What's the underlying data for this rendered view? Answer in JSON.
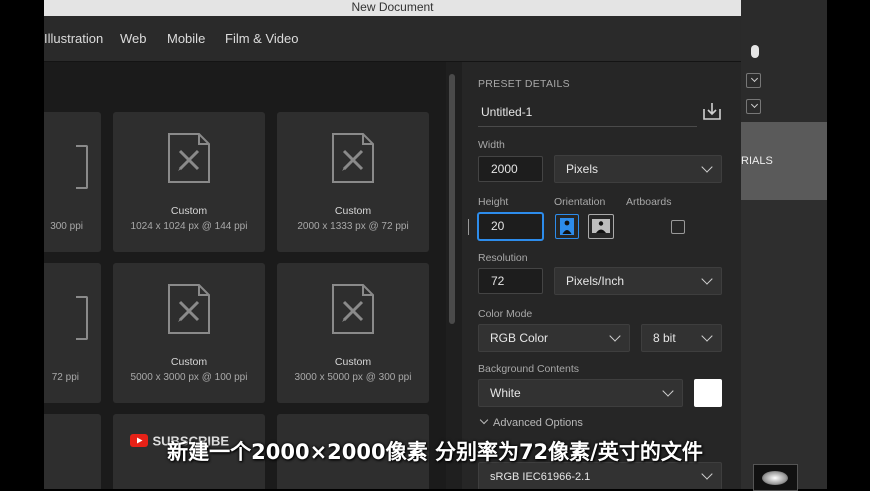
{
  "window": {
    "title": "New Document"
  },
  "tabs": [
    "Illustration",
    "Web",
    "Mobile",
    "Film & Video"
  ],
  "presets": [
    {
      "name": "",
      "detail": "300 ppi"
    },
    {
      "name": "Custom",
      "detail": "1024 x 1024 px @ 144 ppi"
    },
    {
      "name": "Custom",
      "detail": "2000 x 1333 px @ 72 ppi"
    },
    {
      "name": "",
      "detail": "72 ppi"
    },
    {
      "name": "Custom",
      "detail": "5000 x 3000 px @ 100 ppi"
    },
    {
      "name": "Custom",
      "detail": "3000 x 5000 px @ 300 ppi"
    }
  ],
  "preset_details": {
    "header": "PRESET DETAILS",
    "doc_name": "Untitled-1",
    "width_label": "Width",
    "width_value": "2000",
    "width_unit": "Pixels",
    "height_label": "Height",
    "height_value": "20",
    "orientation_label": "Orientation",
    "artboards_label": "Artboards",
    "resolution_label": "Resolution",
    "resolution_value": "72",
    "resolution_unit": "Pixels/Inch",
    "color_mode_label": "Color Mode",
    "color_mode": "RGB Color",
    "bit_depth": "8 bit",
    "bg_label": "Background Contents",
    "bg_value": "White",
    "advanced_label": "Advanced Options",
    "profile": "sRGB IEC61966-2.1"
  },
  "right_app": {
    "partial_text": "RIALS"
  },
  "watermark": "SUBSCRIBE",
  "subtitle": "新建一个2000×2000像素 分别率为72像素/英寸的文件",
  "colors": {
    "accent": "#2d8ceb",
    "panel": "#262626",
    "card": "#2e2e2e",
    "swatch": "#ffffff"
  }
}
